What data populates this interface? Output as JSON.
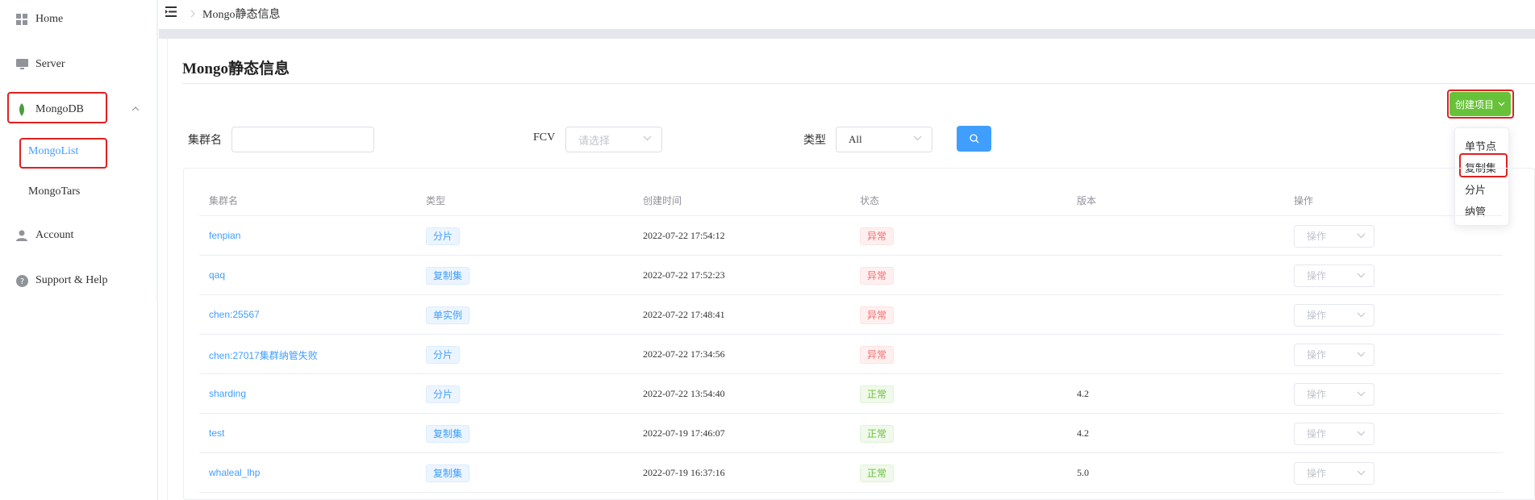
{
  "sidebar": {
    "items": [
      {
        "label": "Home",
        "icon": "grid-icon"
      },
      {
        "label": "Server",
        "icon": "monitor-icon"
      },
      {
        "label": "MongoDB",
        "icon": "leaf-icon"
      },
      {
        "label": "Account",
        "icon": "user-icon"
      },
      {
        "label": "Support & Help",
        "icon": "help-icon"
      }
    ],
    "subitems": [
      {
        "label": "MongoList"
      },
      {
        "label": "MongoTars"
      }
    ]
  },
  "header": {
    "breadcrumb": "Mongo静态信息",
    "menu_icon": "menu-toggle-icon"
  },
  "main": {
    "title": "Mongo静态信息",
    "create_button": "创建项目",
    "dropdown": [
      "单节点",
      "复制集",
      "分片",
      "纳管"
    ],
    "filters": {
      "cluster_label": "集群名",
      "cluster_value": "",
      "fcv_label": "FCV",
      "fcv_placeholder": "请选择",
      "type_label": "类型",
      "type_value": "All"
    },
    "table": {
      "headers": [
        "集群名",
        "类型",
        "创建时间",
        "状态",
        "版本",
        "操作"
      ],
      "rows": [
        {
          "name": "fenpian",
          "type": "分片",
          "time": "2022-07-22 17:54:12",
          "status": "异常",
          "version": "",
          "action": "操作"
        },
        {
          "name": "qaq",
          "type": "复制集",
          "time": "2022-07-22 17:52:23",
          "status": "异常",
          "version": "",
          "action": "操作"
        },
        {
          "name": "chen:25567",
          "type": "单实例",
          "time": "2022-07-22 17:48:41",
          "status": "异常",
          "version": "",
          "action": "操作"
        },
        {
          "name": "chen:27017集群纳管失败",
          "type": "分片",
          "time": "2022-07-22 17:34:56",
          "status": "异常",
          "version": "",
          "action": "操作"
        },
        {
          "name": "sharding",
          "type": "分片",
          "time": "2022-07-22 13:54:40",
          "status": "正常",
          "version": "4.2",
          "action": "操作"
        },
        {
          "name": "test",
          "type": "复制集",
          "time": "2022-07-19 17:46:07",
          "status": "正常",
          "version": "4.2",
          "action": "操作"
        },
        {
          "name": "whaleal_lhp",
          "type": "复制集",
          "time": "2022-07-19 16:37:16",
          "status": "正常",
          "version": "5.0",
          "action": "操作"
        }
      ]
    }
  },
  "colors": {
    "primary": "#409eff",
    "success": "#67c23a",
    "danger": "#f56c6c",
    "highlight": "#e02020"
  }
}
